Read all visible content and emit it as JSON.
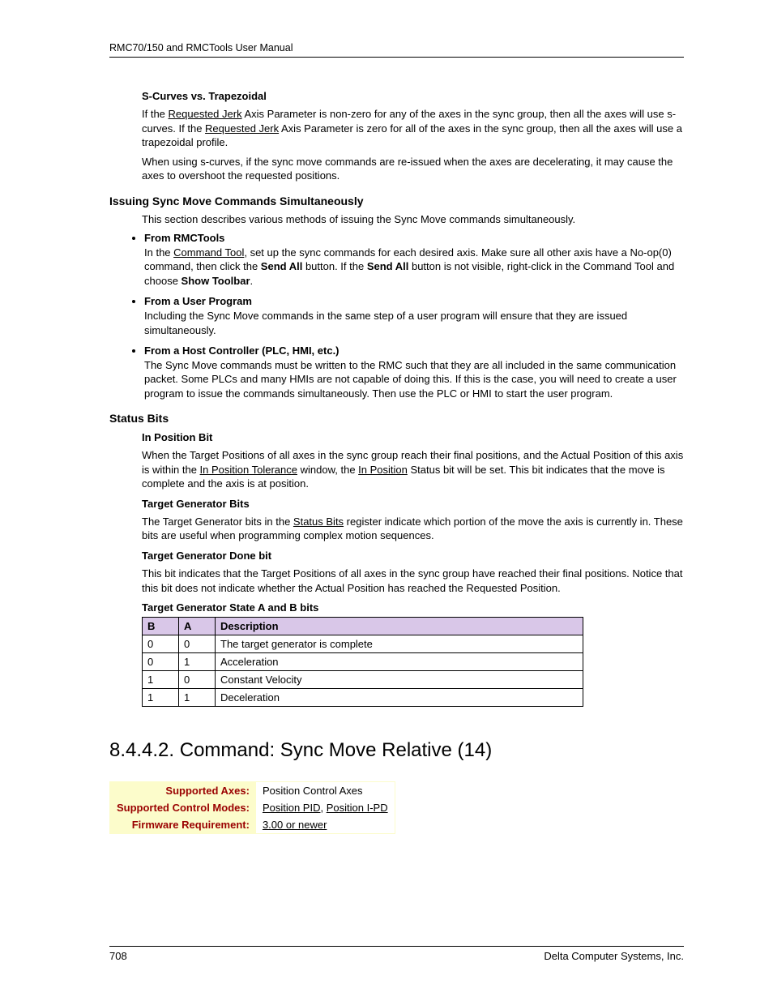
{
  "header": {
    "title": "RMC70/150 and RMCTools User Manual"
  },
  "scurves": {
    "heading": "S-Curves vs. Trapezoidal",
    "p1a": "If the ",
    "p1_link1": "Requested Jerk",
    "p1b": " Axis Parameter is non-zero for any of the axes in the sync group, then all the axes will use s-curves. If the ",
    "p1_link2": "Requested Jerk",
    "p1c": " Axis Parameter is zero for all of the axes in the sync group, then all the axes will use a trapezoidal profile.",
    "p2": "When using s-curves, if the sync move commands are re-issued when the axes are decelerating, it may cause the axes to overshoot the requested positions."
  },
  "issuing": {
    "heading": "Issuing Sync Move Commands Simultaneously",
    "intro": "This section describes various methods of issuing the Sync Move commands simultaneously.",
    "items": [
      {
        "title": "From RMCTools",
        "a": "In the ",
        "link": "Command Tool",
        "b": ", set up the sync commands for each desired axis. Make sure all other axis have a No-op(0) command, then click the ",
        "bold1": "Send All",
        "c": " button. If the ",
        "bold2": "Send All",
        "d": " button is not visible, right-click in the Command Tool and choose ",
        "bold3": "Show Toolbar",
        "e": "."
      },
      {
        "title": "From a User Program",
        "text": "Including the Sync Move commands in the same step of a user program will ensure that they are issued simultaneously."
      },
      {
        "title": "From a Host Controller (PLC, HMI, etc.)",
        "text": "The Sync Move commands must be written to the RMC such that they are all included in the same communication packet. Some PLCs and many HMIs are not capable of doing this. If this is the case, you will need to create a user program to issue the commands simultaneously. Then use the PLC or HMI to start the user program."
      }
    ]
  },
  "status": {
    "heading": "Status Bits",
    "inpos": {
      "heading": "In Position Bit",
      "a": "When the Target Positions of all axes in the sync group reach their final positions, and the Actual Position of this axis is within the ",
      "link1": "In Position Tolerance",
      "b": " window, the ",
      "link2": "In Position",
      "c": " Status bit will be set. This bit indicates that the move is complete and the axis is at position."
    },
    "tgb": {
      "heading": "Target Generator Bits",
      "a": "The Target Generator bits in the ",
      "link": "Status Bits",
      "b": " register indicate which portion of the move the axis is currently in. These bits are useful when programming complex motion sequences."
    },
    "done": {
      "heading": "Target Generator Done bit",
      "text": "This bit indicates that the Target Positions of all axes in the sync group have reached their final positions. Notice that this bit does not indicate whether the Actual Position has reached the Requested Position."
    },
    "state": {
      "heading": "Target Generator State A and B bits",
      "headers": {
        "b": "B",
        "a": "A",
        "desc": "Description"
      },
      "rows": [
        {
          "b": "0",
          "a": "0",
          "desc": "The target generator is complete"
        },
        {
          "b": "0",
          "a": "1",
          "desc": "Acceleration"
        },
        {
          "b": "1",
          "a": "0",
          "desc": "Constant Velocity"
        },
        {
          "b": "1",
          "a": "1",
          "desc": "Deceleration"
        }
      ]
    }
  },
  "cmd": {
    "heading": "8.4.4.2. Command: Sync Move Relative (14)",
    "rows": [
      {
        "label": "Supported Axes:",
        "value": "Position Control Axes",
        "linked": false
      },
      {
        "label": "Supported Control Modes:",
        "link1": "Position PID",
        "sep": ", ",
        "link2": "Position I-PD"
      },
      {
        "label": "Firmware Requirement:",
        "link1": "3.00 or newer"
      }
    ]
  },
  "footer": {
    "page": "708",
    "company": "Delta Computer Systems, Inc."
  }
}
